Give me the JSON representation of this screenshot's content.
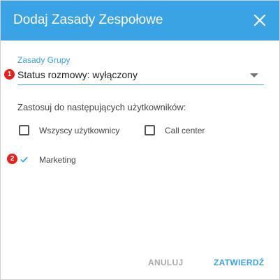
{
  "dialog": {
    "title": "Dodaj Zasady Zespołowe",
    "close_icon": "close-icon"
  },
  "policy_select": {
    "label": "Zasady Grupy",
    "value": "Status rozmowy: wyłączony",
    "annotation": "1"
  },
  "users": {
    "instruction": "Zastosuj do następujących użytkowników:",
    "options": [
      {
        "label": "Wszyscy użytkownicy",
        "checked": false
      },
      {
        "label": "Call center",
        "checked": false
      },
      {
        "label": "Marketing",
        "checked": true,
        "annotation": "2"
      }
    ]
  },
  "actions": {
    "cancel_label": "ANULUJ",
    "confirm_label": "ZATWIERDŹ"
  },
  "colors": {
    "accent": "#3aa3e3",
    "badge": "#e8201c",
    "muted_button": "#a9a9a9"
  }
}
